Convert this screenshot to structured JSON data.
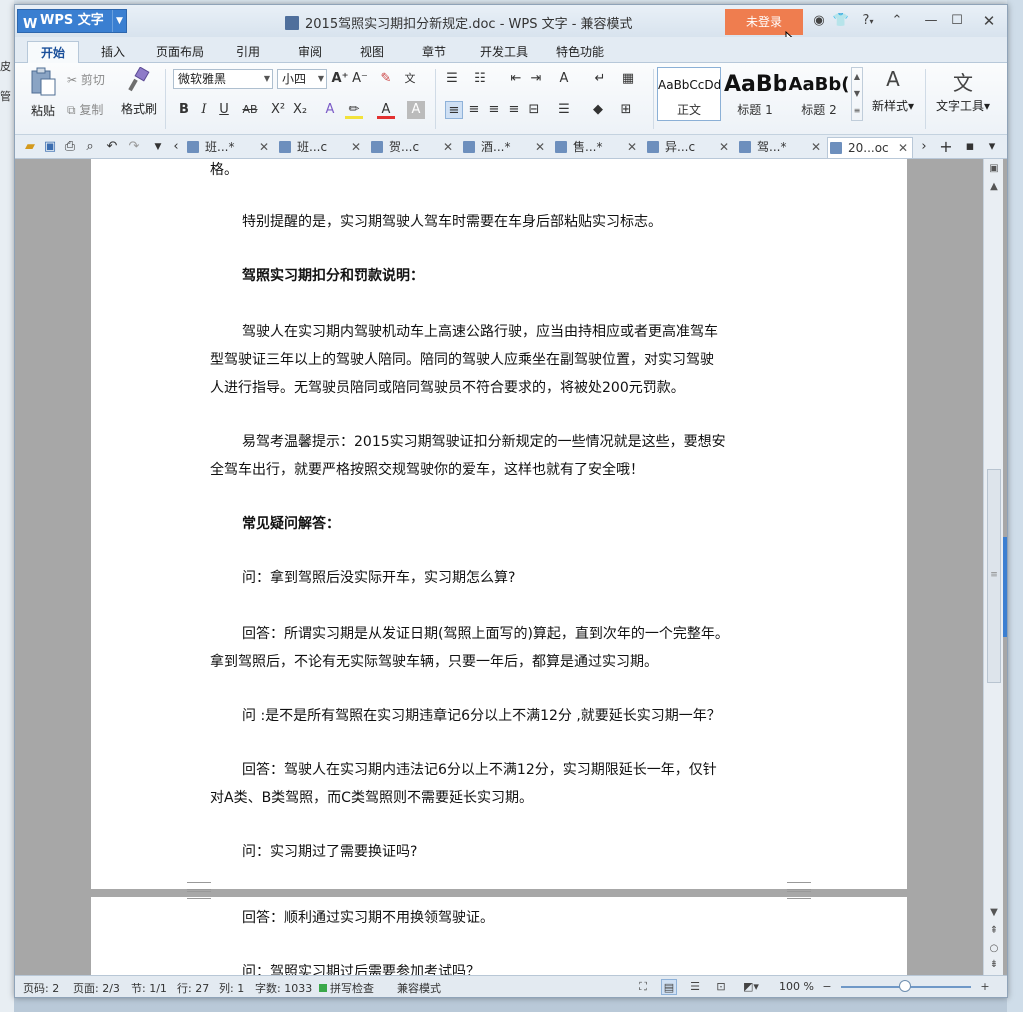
{
  "desktop": {
    "left_labels": [
      "皮",
      "管"
    ]
  },
  "titlebar": {
    "app_name": "WPS 文字",
    "doc_title": "2015驾照实习期扣分新规定.doc - WPS 文字 - 兼容模式",
    "login": "未登录",
    "help": "?"
  },
  "menu_tabs": [
    "开始",
    "插入",
    "页面布局",
    "引用",
    "审阅",
    "视图",
    "章节",
    "开发工具",
    "特色功能"
  ],
  "ribbon": {
    "paste": "粘贴",
    "cut": "剪切",
    "copy": "复制",
    "format_painter": "格式刷",
    "font_name": "微软雅黑",
    "font_size": "小四",
    "styles": [
      {
        "sample": "AaBbCcDd",
        "label": "正文"
      },
      {
        "sample": "AaBb",
        "label": "标题 1"
      },
      {
        "sample": "AaBb(",
        "label": "标题 2"
      }
    ],
    "new_style": "新样式",
    "text_tools": "文字工具"
  },
  "doc_tabs": [
    {
      "label": "班...*"
    },
    {
      "label": "班...c"
    },
    {
      "label": "贺...c"
    },
    {
      "label": "酒...*"
    },
    {
      "label": "售...*"
    },
    {
      "label": "异...c"
    },
    {
      "label": "驾...*"
    },
    {
      "label": "20...oc",
      "active": true
    }
  ],
  "document": {
    "page1_lines": [
      {
        "text": "格。",
        "bold": false,
        "indent": false
      },
      {
        "text": "特别提醒的是，实习期驾驶人驾车时需要在车身后部粘贴实习标志。",
        "bold": false,
        "indent": true
      },
      {
        "text": "驾照实习期扣分和罚款说明：",
        "bold": true,
        "indent": true
      },
      {
        "text": "驾驶人在实习期内驾驶机动车上高速公路行驶，应当由持相应或者更高准驾车",
        "bold": false,
        "indent": true
      },
      {
        "text": "型驾驶证三年以上的驾驶人陪同。陪同的驾驶人应乘坐在副驾驶位置，对实习驾驶",
        "bold": false,
        "indent": false
      },
      {
        "text": "人进行指导。无驾驶员陪同或陪同驾驶员不符合要求的，将被处200元罚款。",
        "bold": false,
        "indent": false
      },
      {
        "text": "易驾考温馨提示：2015实习期驾驶证扣分新规定的一些情况就是这些，要想安",
        "bold": false,
        "indent": true
      },
      {
        "text": "全驾车出行，就要严格按照交规驾驶你的爱车，这样也就有了安全哦！",
        "bold": false,
        "indent": false
      },
      {
        "text": "常见疑问解答：",
        "bold": true,
        "indent": true
      },
      {
        "text": "问：拿到驾照后没实际开车，实习期怎么算?",
        "bold": false,
        "indent": true
      },
      {
        "text": "回答：所谓实习期是从发证日期(驾照上面写的)算起，直到次年的一个完整年。",
        "bold": false,
        "indent": true
      },
      {
        "text": "拿到驾照后，不论有无实际驾驶车辆，只要一年后，都算是通过实习期。",
        "bold": false,
        "indent": false
      },
      {
        "text": "问 :是不是所有驾照在实习期违章记6分以上不满12分 ,就要延长实习期一年？",
        "bold": false,
        "indent": true
      },
      {
        "text": "回答：驾驶人在实习期内违法记6分以上不满12分，实习期限延长一年，仅针",
        "bold": false,
        "indent": true
      },
      {
        "text": "对A类、B类驾照，而C类驾照则不需要延长实习期。",
        "bold": false,
        "indent": false
      },
      {
        "text": "问：实习期过了需要换证吗?",
        "bold": false,
        "indent": true
      }
    ],
    "page2_lines": [
      {
        "text": "回答：顺利通过实习期不用换领驾驶证。",
        "bold": false,
        "indent": true
      },
      {
        "text": "问：驾照实习期过后需要参加考试吗？",
        "bold": false,
        "indent": true
      }
    ]
  },
  "statusbar": {
    "page_num": "页码: 2",
    "pages": "页面: 2/3",
    "section": "节: 1/1",
    "row": "行: 27",
    "col": "列: 1",
    "words": "字数: 1033",
    "spell": "拼写检查",
    "compat": "兼容模式",
    "zoom": "100 %"
  }
}
